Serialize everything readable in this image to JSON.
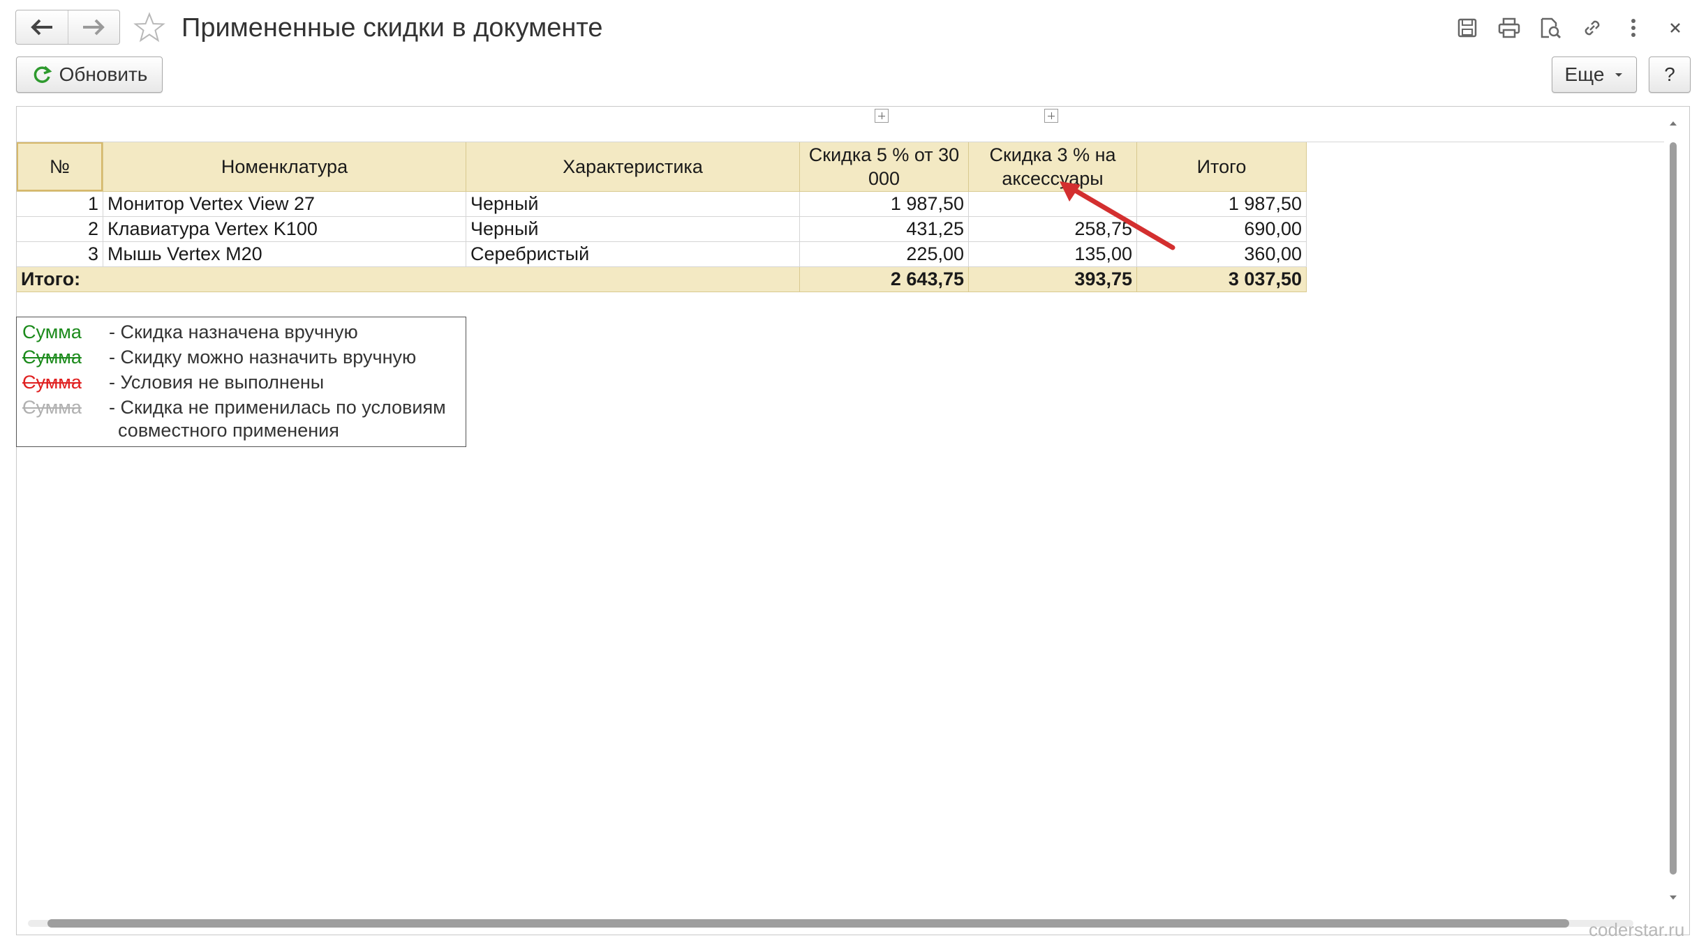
{
  "window": {
    "title": "Примененные скидки в документе",
    "back_icon": "arrow-left-icon",
    "forward_icon": "arrow-right-icon",
    "favorite_icon": "star-icon",
    "toolbar_icons": [
      "save-icon",
      "print-icon",
      "preview-icon",
      "link-icon",
      "more-vert-icon",
      "close-icon"
    ]
  },
  "commands": {
    "refresh_label": "Обновить",
    "more_label": "Еще",
    "help_label": "?"
  },
  "report": {
    "headers": {
      "no": "№",
      "item": "Номенклатура",
      "characteristic": "Характеристика",
      "discount1": "Скидка 5 % от 30 000",
      "discount2": "Скидка 3 % на аксессуары",
      "total": "Итого"
    },
    "rows": [
      {
        "no": "1",
        "item": "Монитор Vertex View 27",
        "characteristic": "Черный",
        "discount1": "1 987,50",
        "discount2": "",
        "total": "1 987,50"
      },
      {
        "no": "2",
        "item": "Клавиатура Vertex K100",
        "characteristic": "Черный",
        "discount1": "431,25",
        "discount2": "258,75",
        "total": "690,00"
      },
      {
        "no": "3",
        "item": "Мышь Vertex M20",
        "characteristic": "Серебристый",
        "discount1": "225,00",
        "discount2": "135,00",
        "total": "360,00"
      }
    ],
    "totals": {
      "label": "Итого:",
      "discount1": "2 643,75",
      "discount2": "393,75",
      "total": "3 037,50"
    },
    "colors": {
      "header_bg": "#f3e9c3",
      "annotation_arrow": "#d32f2f"
    }
  },
  "legend": {
    "items": [
      {
        "sample": "Сумма",
        "desc": "- Скидка назначена вручную",
        "color": "#1b8a1b"
      },
      {
        "sample": "Сумма",
        "desc": "- Скидку можно назначить вручную",
        "color": "#1b8a1b"
      },
      {
        "sample": "Сумма",
        "desc": "- Условия не выполнены",
        "color": "#e02020"
      },
      {
        "sample": "Сумма",
        "desc": "- Скидка не применилась по условиям",
        "color": "#b0b0b0"
      }
    ],
    "desc_continuation": "совместного применения"
  },
  "watermark": "coderstar.ru"
}
